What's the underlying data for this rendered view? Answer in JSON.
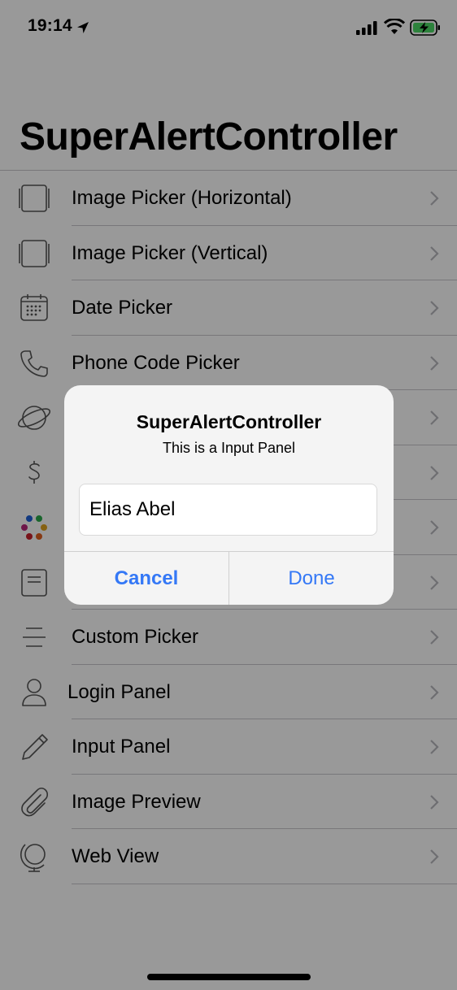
{
  "status_bar": {
    "time": "19:14",
    "icons": [
      "location-arrow-icon",
      "cellular-signal-icon",
      "wifi-icon",
      "battery-charging-icon"
    ]
  },
  "large_title": "SuperAlertController",
  "menu": [
    {
      "label": "Image Picker (Horizontal)",
      "icon": "image-frame-icon"
    },
    {
      "label": "Image Picker (Vertical)",
      "icon": "image-frame-icon"
    },
    {
      "label": "Date Picker",
      "icon": "calendar-icon"
    },
    {
      "label": "Phone Code Picker",
      "icon": "phone-icon"
    },
    {
      "label": "",
      "icon": "planet-icon"
    },
    {
      "label": "",
      "icon": "dollar-icon"
    },
    {
      "label": "",
      "icon": "color-dots-icon"
    },
    {
      "label": "",
      "icon": "note-icon"
    },
    {
      "label": "Custom Picker",
      "icon": "lines-icon"
    },
    {
      "label": "Login Panel",
      "icon": "person-icon"
    },
    {
      "label": "Input Panel",
      "icon": "pencil-icon"
    },
    {
      "label": "Image Preview",
      "icon": "paperclip-icon"
    },
    {
      "label": "Web View",
      "icon": "globe-icon"
    }
  ],
  "alert": {
    "title": "SuperAlertController",
    "message": "This is a Input Panel",
    "input_value": "Elias Abel",
    "cancel_label": "Cancel",
    "done_label": "Done"
  },
  "colors": {
    "accent": "#3478f6",
    "separator": "#c8c7cc",
    "overlay": "rgba(0,0,0,0.4)",
    "icon_stroke": "#555555"
  }
}
